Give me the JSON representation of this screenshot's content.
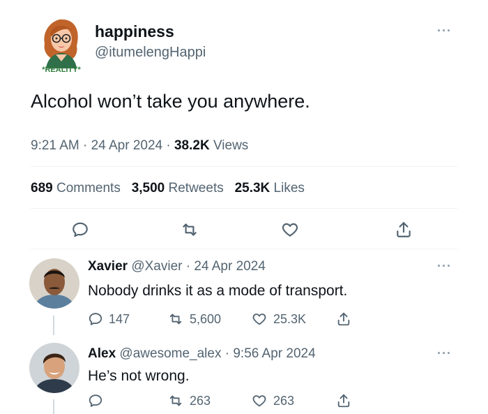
{
  "tweet": {
    "display_name": "happiness",
    "handle": "@itumelengHappi",
    "avatar_badge": "*REALITY*",
    "text": "Alcohol won’t take you anywhere.",
    "time": "9:21 AM",
    "sep1": "·",
    "date": "24 Apr 2024",
    "sep2": "·",
    "views_count": "38.2K",
    "views_label": "Views",
    "comments_count": "689",
    "comments_label": "Comments",
    "retweets_count": "3,500",
    "retweets_label": "Retweets",
    "likes_count": "25.3K",
    "likes_label": "Likes",
    "more": "···"
  },
  "replies": [
    {
      "display_name": "Xavier",
      "handle": "@Xavier",
      "sep": "·",
      "date": "24 Apr 2024",
      "text": "Nobody drinks it as a mode of transport.",
      "replies": "147",
      "retweets": "5,600",
      "likes": "25.3K",
      "more": "···"
    },
    {
      "display_name": "Alex",
      "handle": "@awesome_alex",
      "sep": "·",
      "date": "9:56 Apr 2024",
      "text": "He’s not wrong.",
      "replies": "",
      "retweets": "263",
      "likes": "263",
      "more": "···"
    }
  ],
  "colors": {
    "text": "#0f1419",
    "secondary": "#536471",
    "divider": "#eff3f4",
    "thread": "#cfd9de"
  },
  "icons": [
    "reply-icon",
    "retweet-icon",
    "like-icon",
    "share-icon",
    "more-icon"
  ]
}
